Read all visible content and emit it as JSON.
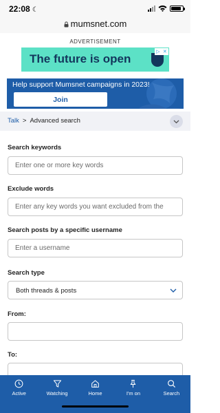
{
  "status_bar": {
    "time": "22:08",
    "battery_level": 0.9
  },
  "browser": {
    "domain": "mumsnet.com"
  },
  "ad": {
    "label": "ADVERTISEMENT",
    "headline": "The future is open",
    "colors": {
      "background": "#5ce1c6",
      "text": "#13365c"
    }
  },
  "campaign": {
    "text": "Help support Mumsnet campaigns in 2023!",
    "button_label": "Join",
    "color": "#1e5da8"
  },
  "breadcrumb": {
    "parent": "Talk",
    "separator": ">",
    "current": "Advanced search"
  },
  "form": {
    "keywords": {
      "label": "Search keywords",
      "placeholder": "Enter one or more key words"
    },
    "exclude": {
      "label": "Exclude words",
      "placeholder": "Enter any key words you want excluded from the"
    },
    "username": {
      "label": "Search posts by a specific username",
      "placeholder": "Enter a username"
    },
    "search_type": {
      "label": "Search type",
      "value": "Both threads & posts"
    },
    "from": {
      "label": "From:"
    },
    "to": {
      "label": "To:"
    }
  },
  "bottom_nav": [
    {
      "label": "Active",
      "icon": "clock-icon"
    },
    {
      "label": "Watching",
      "icon": "filter-icon"
    },
    {
      "label": "Home",
      "icon": "home-icon"
    },
    {
      "label": "I'm on",
      "icon": "pin-icon"
    },
    {
      "label": "Search",
      "icon": "search-icon"
    }
  ]
}
